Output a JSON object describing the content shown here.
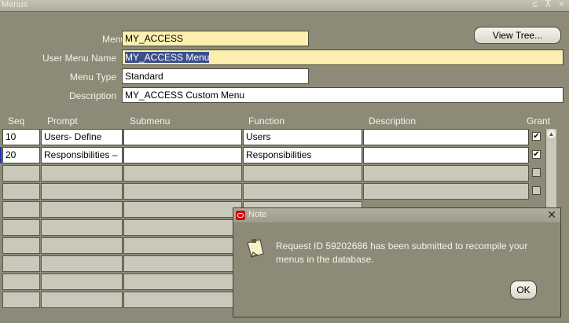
{
  "window": {
    "title": "Menus",
    "controls": "≤ ⊼ ×"
  },
  "header": {
    "menu_label": "Menu",
    "menu_value": "MY_ACCESS",
    "user_menu_name_label": "User Menu Name",
    "user_menu_name_value": "MY_ACCESS Menu",
    "menu_type_label": "Menu Type",
    "menu_type_value": "Standard",
    "description_label": "Description",
    "description_value": "MY_ACCESS Custom Menu",
    "view_tree_label": "View Tree..."
  },
  "table": {
    "columns": [
      "Seq",
      "Prompt",
      "Submenu",
      "Function",
      "Description",
      "Grant"
    ],
    "rows": [
      {
        "seq": "10",
        "prompt": "Users- Define",
        "submenu": "",
        "function": "Users",
        "description": "",
        "grant": true
      },
      {
        "seq": "20",
        "prompt": "Responsibilities –",
        "submenu": "",
        "function": "Responsibilities",
        "description": "",
        "grant": true
      }
    ]
  },
  "note_dialog": {
    "title": "Note",
    "message": "Request ID  59202686 has been submitted to recompile your menus in the database.",
    "ok_label": "OK"
  },
  "colors": {
    "background": "#8d8b77",
    "required_field": "#fcefb0",
    "selection": "#3c4f8a",
    "oracle_red": "#d10b0b"
  },
  "icons": [
    "window-minimize-icon",
    "window-maximize-icon",
    "window-close-icon",
    "oracle-logo-icon",
    "note-icon",
    "dialog-close-icon",
    "scroll-up-icon"
  ]
}
